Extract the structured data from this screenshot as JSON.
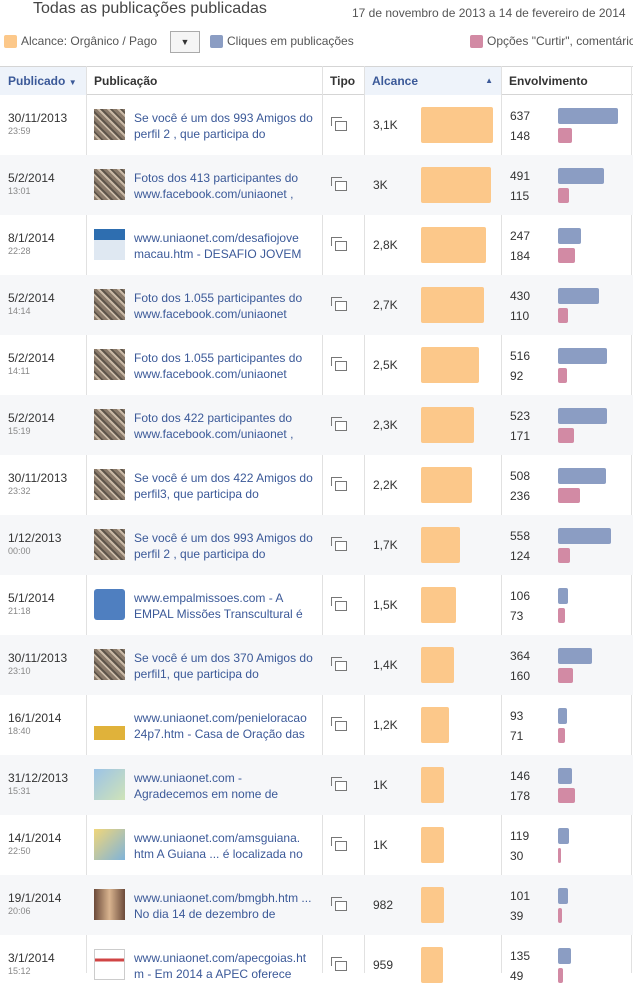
{
  "header": {
    "title": "Todas as publicações publicadas",
    "date_range": "17 de novembro de 2013 a 14 de fevereiro de 2014"
  },
  "legend": {
    "reach": "Alcance: Orgânico / Pago",
    "clicks": "Cliques em publicações",
    "likes": "Opções \"Curtir\", comentários"
  },
  "colors": {
    "reach": "#fcc88a",
    "clicks": "#8b9dc3",
    "likes": "#d28aa4",
    "link": "#3b5998"
  },
  "columns": {
    "published": "Publicado",
    "post": "Publicação",
    "type": "Tipo",
    "reach": "Alcance",
    "engagement": "Envolvimento"
  },
  "reach_max": 3100,
  "engagement_max": 637,
  "rows": [
    {
      "date": "30/11/2013",
      "time": "23:59",
      "text": "Se você é um dos 993 Amigos do perfil 2 , que participa do",
      "reach_label": "3,1K",
      "reach": 3100,
      "clicks": 637,
      "likes": 148,
      "thumb": "mosaic"
    },
    {
      "date": "5/2/2014",
      "time": "13:01",
      "text": "Fotos dos 413 participantes do www.facebook.com/uniaonet ,",
      "reach_label": "3K",
      "reach": 3000,
      "clicks": 491,
      "likes": 115,
      "thumb": "mosaic"
    },
    {
      "date": "8/1/2014",
      "time": "22:28",
      "text": "www.uniaonet.com/desafiojove macau.htm - DESAFIO JOVEM",
      "reach_label": "2,8K",
      "reach": 2800,
      "clicks": 247,
      "likes": 184,
      "thumb": "web"
    },
    {
      "date": "5/2/2014",
      "time": "14:14",
      "text": "Foto dos 1.055 participantes do www.facebook.com/uniaonet",
      "reach_label": "2,7K",
      "reach": 2700,
      "clicks": 430,
      "likes": 110,
      "thumb": "mosaic"
    },
    {
      "date": "5/2/2014",
      "time": "14:11",
      "text": "Foto dos 1.055 participantes do www.facebook.com/uniaonet",
      "reach_label": "2,5K",
      "reach": 2500,
      "clicks": 516,
      "likes": 92,
      "thumb": "mosaic"
    },
    {
      "date": "5/2/2014",
      "time": "15:19",
      "text": "Foto dos 422 participantes do www.facebook.com/uniaonet ,",
      "reach_label": "2,3K",
      "reach": 2300,
      "clicks": 523,
      "likes": 171,
      "thumb": "mosaic"
    },
    {
      "date": "30/11/2013",
      "time": "23:32",
      "text": "Se você é um dos 422 Amigos do perfil3, que participa do",
      "reach_label": "2,2K",
      "reach": 2200,
      "clicks": 508,
      "likes": 236,
      "thumb": "mosaic"
    },
    {
      "date": "1/12/2013",
      "time": "00:00",
      "text": "Se você é um dos 993 Amigos do perfil 2 , que participa do",
      "reach_label": "1,7K",
      "reach": 1700,
      "clicks": 558,
      "likes": 124,
      "thumb": "mosaic"
    },
    {
      "date": "5/1/2014",
      "time": "21:18",
      "text": "www.empalmissoes.com - A EMPAL Missões Transcultural é",
      "reach_label": "1,5K",
      "reach": 1500,
      "clicks": 106,
      "likes": 73,
      "thumb": "logo"
    },
    {
      "date": "30/11/2013",
      "time": "23:10",
      "text": "Se você é um dos 370 Amigos do perfil1, que participa do",
      "reach_label": "1,4K",
      "reach": 1400,
      "clicks": 364,
      "likes": 160,
      "thumb": "mosaic"
    },
    {
      "date": "16/1/2014",
      "time": "18:40",
      "text": "www.uniaonet.com/penieloracao 24p7.htm - Casa de Oração das",
      "reach_label": "1,2K",
      "reach": 1200,
      "clicks": 93,
      "likes": 71,
      "thumb": "menorah"
    },
    {
      "date": "31/12/2013",
      "time": "15:31",
      "text": "www.uniaonet.com - Agradecemos em nome de",
      "reach_label": "1K",
      "reach": 1000,
      "clicks": 146,
      "likes": 178,
      "thumb": "map"
    },
    {
      "date": "14/1/2014",
      "time": "22:50",
      "text": "www.uniaonet.com/amsguiana. htm A Guiana ... é localizada no",
      "reach_label": "1K",
      "reach": 1000,
      "clicks": 119,
      "likes": 30,
      "thumb": "map2"
    },
    {
      "date": "19/1/2014",
      "time": "20:06",
      "text": "www.uniaonet.com/bmgbh.htm ... No dia 14 de dezembro de",
      "reach_label": "982",
      "reach": 982,
      "clicks": 101,
      "likes": 39,
      "thumb": "people"
    },
    {
      "date": "3/1/2014",
      "time": "15:12",
      "text": "www.uniaonet.com/apecgoias.ht m - Em 2014 a APEC oferece",
      "reach_label": "959",
      "reach": 959,
      "clicks": 135,
      "likes": 49,
      "thumb": "doc"
    }
  ]
}
